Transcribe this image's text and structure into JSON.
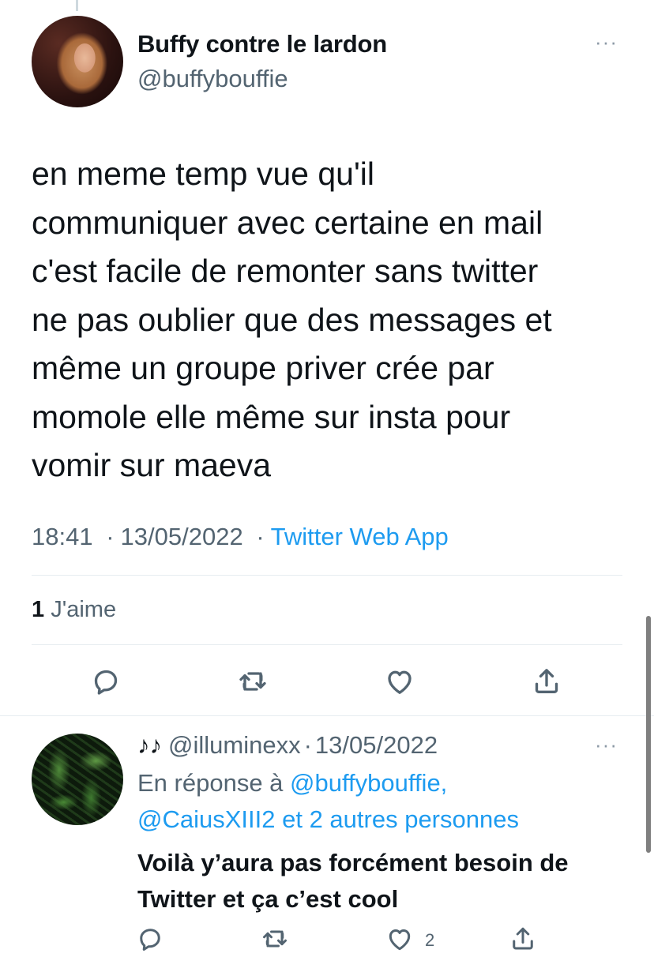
{
  "tweet": {
    "display_name": "Buffy contre le lardon",
    "handle": "@buffybouffie",
    "more_label": "···",
    "text_lines": [
      "en meme temp vue qu'il",
      "communiquer avec certaine en mail",
      "c'est facile de remonter sans twitter",
      "ne pas oublier que des messages et",
      "même un groupe priver crée par",
      "momole elle même sur insta pour",
      "vomir sur maeva"
    ],
    "time": "18:41",
    "date": "13/05/2022",
    "separator": "·",
    "source": "Twitter Web App",
    "likes_count": "1",
    "likes_label": "J'aime",
    "actions": [
      "reply-icon",
      "retweet-icon",
      "like-icon",
      "share-icon"
    ]
  },
  "reply": {
    "emoji": "♪♪",
    "handle": "@illuminexx",
    "separator": "·",
    "date": "13/05/2022",
    "more_label": "···",
    "reply_prefix": "En réponse à",
    "mention_1": "@buffybouffie,",
    "mention_2": "@CaiusXIII2",
    "reply_suffix": "et 2 autres personnes",
    "text_lines": [
      "Voilà y’aura pas forcément besoin de",
      "Twitter et ça c’est cool"
    ],
    "like_count": "2",
    "actions": [
      "reply-icon",
      "retweet-icon",
      "like-icon",
      "share-icon"
    ]
  },
  "colors": {
    "text": "#0f1419",
    "secondary": "#536471",
    "accent": "#1d9bf0",
    "divider": "#e6ecf0"
  }
}
